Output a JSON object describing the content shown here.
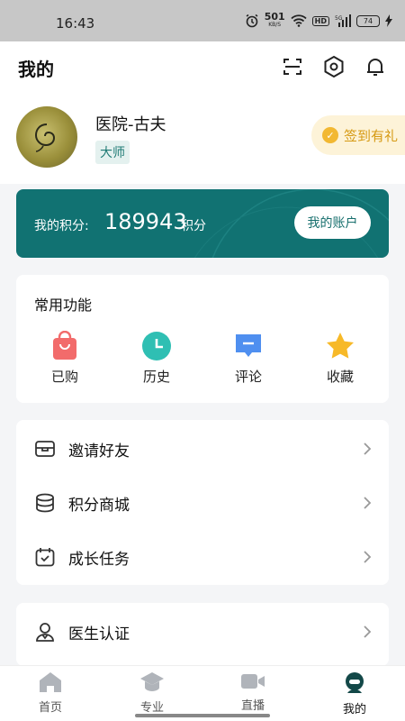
{
  "status": {
    "time": "16:43",
    "net_speed": "501",
    "net_unit": "KB/S",
    "hd": "HD",
    "signal": "5G",
    "battery": "74"
  },
  "header": {
    "title": "我的"
  },
  "profile": {
    "name": "医院-古夫",
    "tag": "大师",
    "signin_label": "签到有礼"
  },
  "points": {
    "label": "我的积分:",
    "value": "189943",
    "unit": "积分",
    "account_button": "我的账户"
  },
  "functions": {
    "title": "常用功能",
    "items": [
      {
        "label": "已购",
        "icon": "shopping-bag-icon",
        "color": "#f26b6b"
      },
      {
        "label": "历史",
        "icon": "clock-icon",
        "color": "#2fbfb3"
      },
      {
        "label": "评论",
        "icon": "comment-icon",
        "color": "#4f8ff0"
      },
      {
        "label": "收藏",
        "icon": "star-icon",
        "color": "#f7b928"
      }
    ]
  },
  "menu": [
    {
      "label": "邀请好友",
      "icon": "invite-icon"
    },
    {
      "label": "积分商城",
      "icon": "coins-icon"
    },
    {
      "label": "成长任务",
      "icon": "calendar-task-icon"
    }
  ],
  "menu2": [
    {
      "label": "医生认证",
      "icon": "doctor-icon"
    }
  ],
  "tabbar": [
    {
      "label": "首页",
      "icon": "home-icon"
    },
    {
      "label": "专业",
      "icon": "graduation-cap-icon"
    },
    {
      "label": "直播",
      "icon": "video-camera-icon"
    },
    {
      "label": "我的",
      "icon": "profile-icon",
      "active": true
    }
  ],
  "colors": {
    "accent": "#117272",
    "tag_bg": "#e4f1ef",
    "signin": "#d69a13"
  }
}
